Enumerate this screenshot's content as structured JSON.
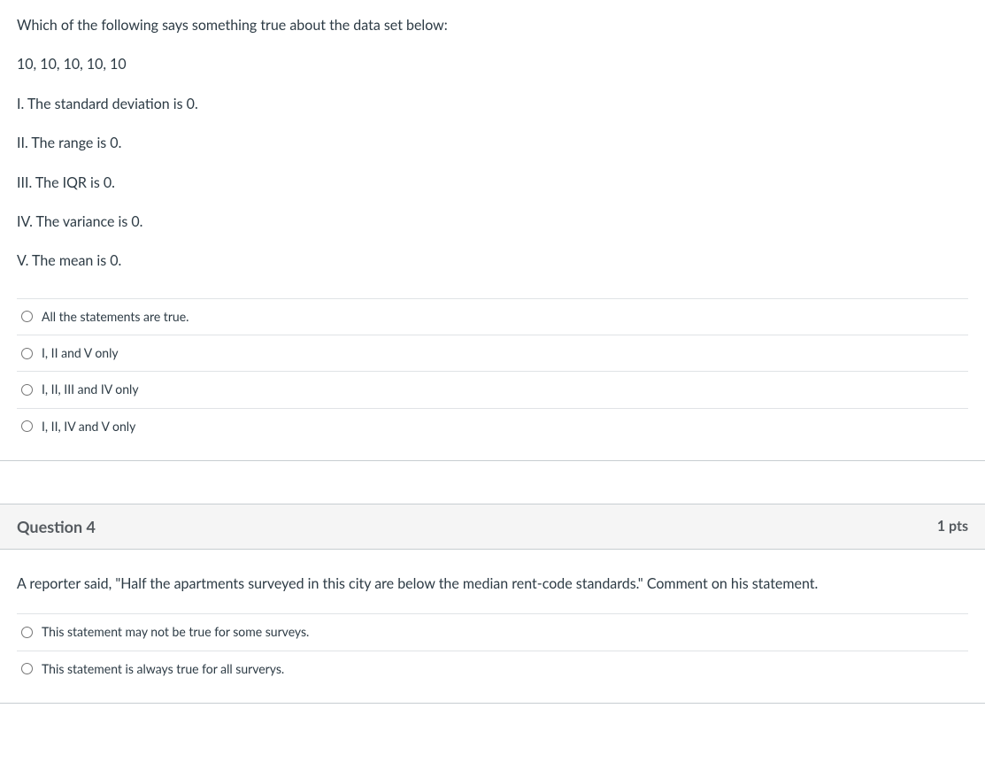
{
  "q3": {
    "prompt_lines": [
      "Which of the following says something true about the data set below:",
      "10, 10, 10, 10, 10",
      "I. The standard deviation is 0.",
      "II. The range is 0.",
      "III. The IQR is 0.",
      "IV. The variance is 0.",
      "V. The mean is 0."
    ],
    "options": [
      "All the statements are true.",
      "I, II and V only",
      "I, II, III and IV only",
      "I, II, IV and V only"
    ]
  },
  "q4": {
    "header": {
      "title": "Question 4",
      "points": "1 pts"
    },
    "prompt": "A reporter said, \"Half the apartments surveyed in this city are below the median rent-code standards.\" Comment on his statement.",
    "options": [
      "This statement may not be true for some surveys.",
      "This statement is always true for all surverys."
    ]
  }
}
